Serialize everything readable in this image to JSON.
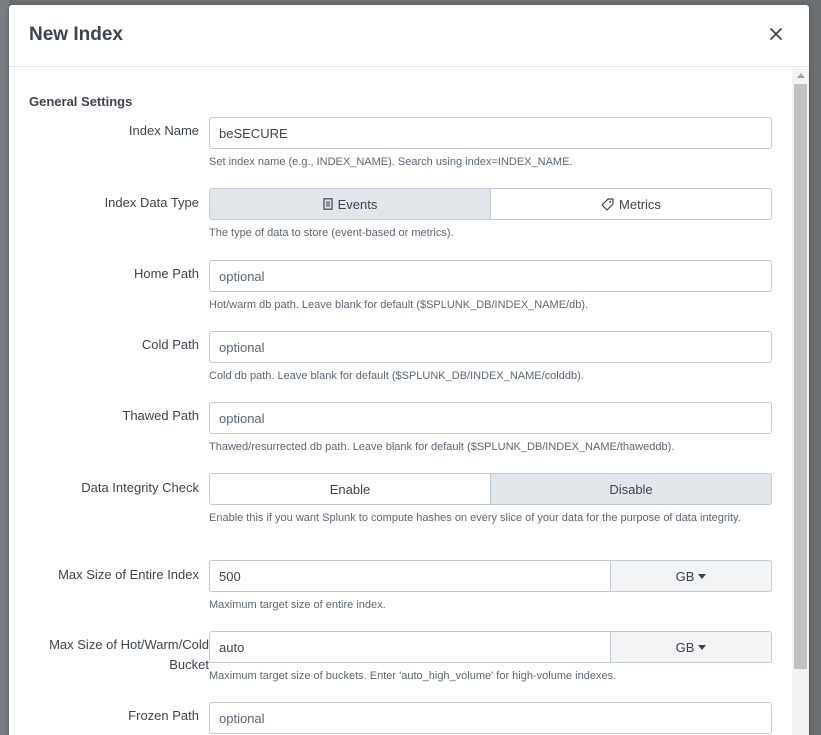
{
  "modal": {
    "title": "New Index"
  },
  "general_settings": {
    "section_title": "General Settings"
  },
  "fields": {
    "index_name": {
      "label": "Index Name",
      "value": "beSECURE",
      "help": "Set index name (e.g., INDEX_NAME). Search using index=INDEX_NAME."
    },
    "index_data_type": {
      "label": "Index Data Type",
      "options": [
        "Events",
        "Metrics"
      ],
      "selected": "Events",
      "help": "The type of data to store (event-based or metrics)."
    },
    "home_path": {
      "label": "Home Path",
      "placeholder": "optional",
      "help": "Hot/warm db path. Leave blank for default ($SPLUNK_DB/INDEX_NAME/db)."
    },
    "cold_path": {
      "label": "Cold Path",
      "placeholder": "optional",
      "help": "Cold db path. Leave blank for default ($SPLUNK_DB/INDEX_NAME/colddb)."
    },
    "thawed_path": {
      "label": "Thawed Path",
      "placeholder": "optional",
      "help": "Thawed/resurrected db path. Leave blank for default ($SPLUNK_DB/INDEX_NAME/thaweddb)."
    },
    "data_integrity_check": {
      "label": "Data Integrity Check",
      "options": [
        "Enable",
        "Disable"
      ],
      "selected": "Disable",
      "help": "Enable this if you want Splunk to compute hashes on every slice of your data for the purpose of data integrity."
    },
    "max_size_index": {
      "label": "Max Size of Entire Index",
      "value": "500",
      "unit": "GB",
      "help": "Maximum target size of entire index."
    },
    "max_size_bucket": {
      "label": "Max Size of Hot/Warm/Cold Bucket",
      "value": "auto",
      "unit": "GB",
      "help": "Maximum target size of buckets. Enter 'auto_high_volume' for high-volume indexes."
    },
    "frozen_path": {
      "label": "Frozen Path",
      "placeholder": "optional"
    }
  },
  "icons": {
    "close": "close-icon",
    "events": "document-icon",
    "metrics": "tag-icon"
  },
  "colors": {
    "text": "#3c444d",
    "help_text": "#5c6773",
    "border": "#c3cbd4",
    "selected_toggle": "#e1e6eb",
    "overlay": "#6b6f72"
  }
}
